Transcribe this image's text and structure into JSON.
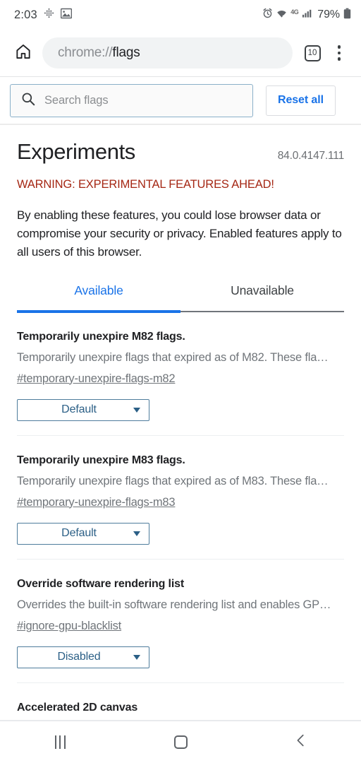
{
  "status_bar": {
    "clock": "2:03",
    "battery_percent": "79%",
    "network_label": "4G",
    "icons": [
      "move-notification-icon",
      "image-notification-icon",
      "alarm-icon",
      "wifi-icon",
      "signal-icon",
      "battery-icon"
    ]
  },
  "toolbar": {
    "url_scheme": "chrome://",
    "url_path": "flags",
    "tab_count": "10",
    "icons": [
      "home-icon",
      "tab-switcher-icon",
      "overflow-menu-icon"
    ]
  },
  "search": {
    "placeholder": "Search flags",
    "value": "",
    "reset_label": "Reset all"
  },
  "page": {
    "title": "Experiments",
    "version": "84.0.4147.111",
    "warning": "WARNING: EXPERIMENTAL FEATURES AHEAD!",
    "blurb": "By enabling these features, you could lose browser data or compromise your security or privacy. Enabled features apply to all users of this browser."
  },
  "tabs": [
    {
      "label": "Available",
      "active": true
    },
    {
      "label": "Unavailable",
      "active": false
    }
  ],
  "flags": [
    {
      "title": "Temporarily unexpire M82 flags.",
      "description": "Temporarily unexpire flags that expired as of M82. These fla…",
      "permalink": "#temporary-unexpire-flags-m82",
      "select_value": "Default"
    },
    {
      "title": "Temporarily unexpire M83 flags.",
      "description": "Temporarily unexpire flags that expired as of M83. These fla…",
      "permalink": "#temporary-unexpire-flags-m83",
      "select_value": "Default"
    },
    {
      "title": "Override software rendering list",
      "description": "Overrides the built-in software rendering list and enables GP…",
      "permalink": "#ignore-gpu-blacklist",
      "select_value": "Disabled"
    }
  ],
  "partial_flag": {
    "title": "Accelerated 2D canvas"
  },
  "nav_bar": {
    "icons": [
      "recents-icon",
      "home-icon",
      "back-icon"
    ]
  },
  "colors": {
    "accent_blue": "#1a73e8",
    "warning_red": "#a52714",
    "select_blue": "#2b5f86",
    "text_primary": "#202124",
    "text_secondary": "#70757a"
  }
}
